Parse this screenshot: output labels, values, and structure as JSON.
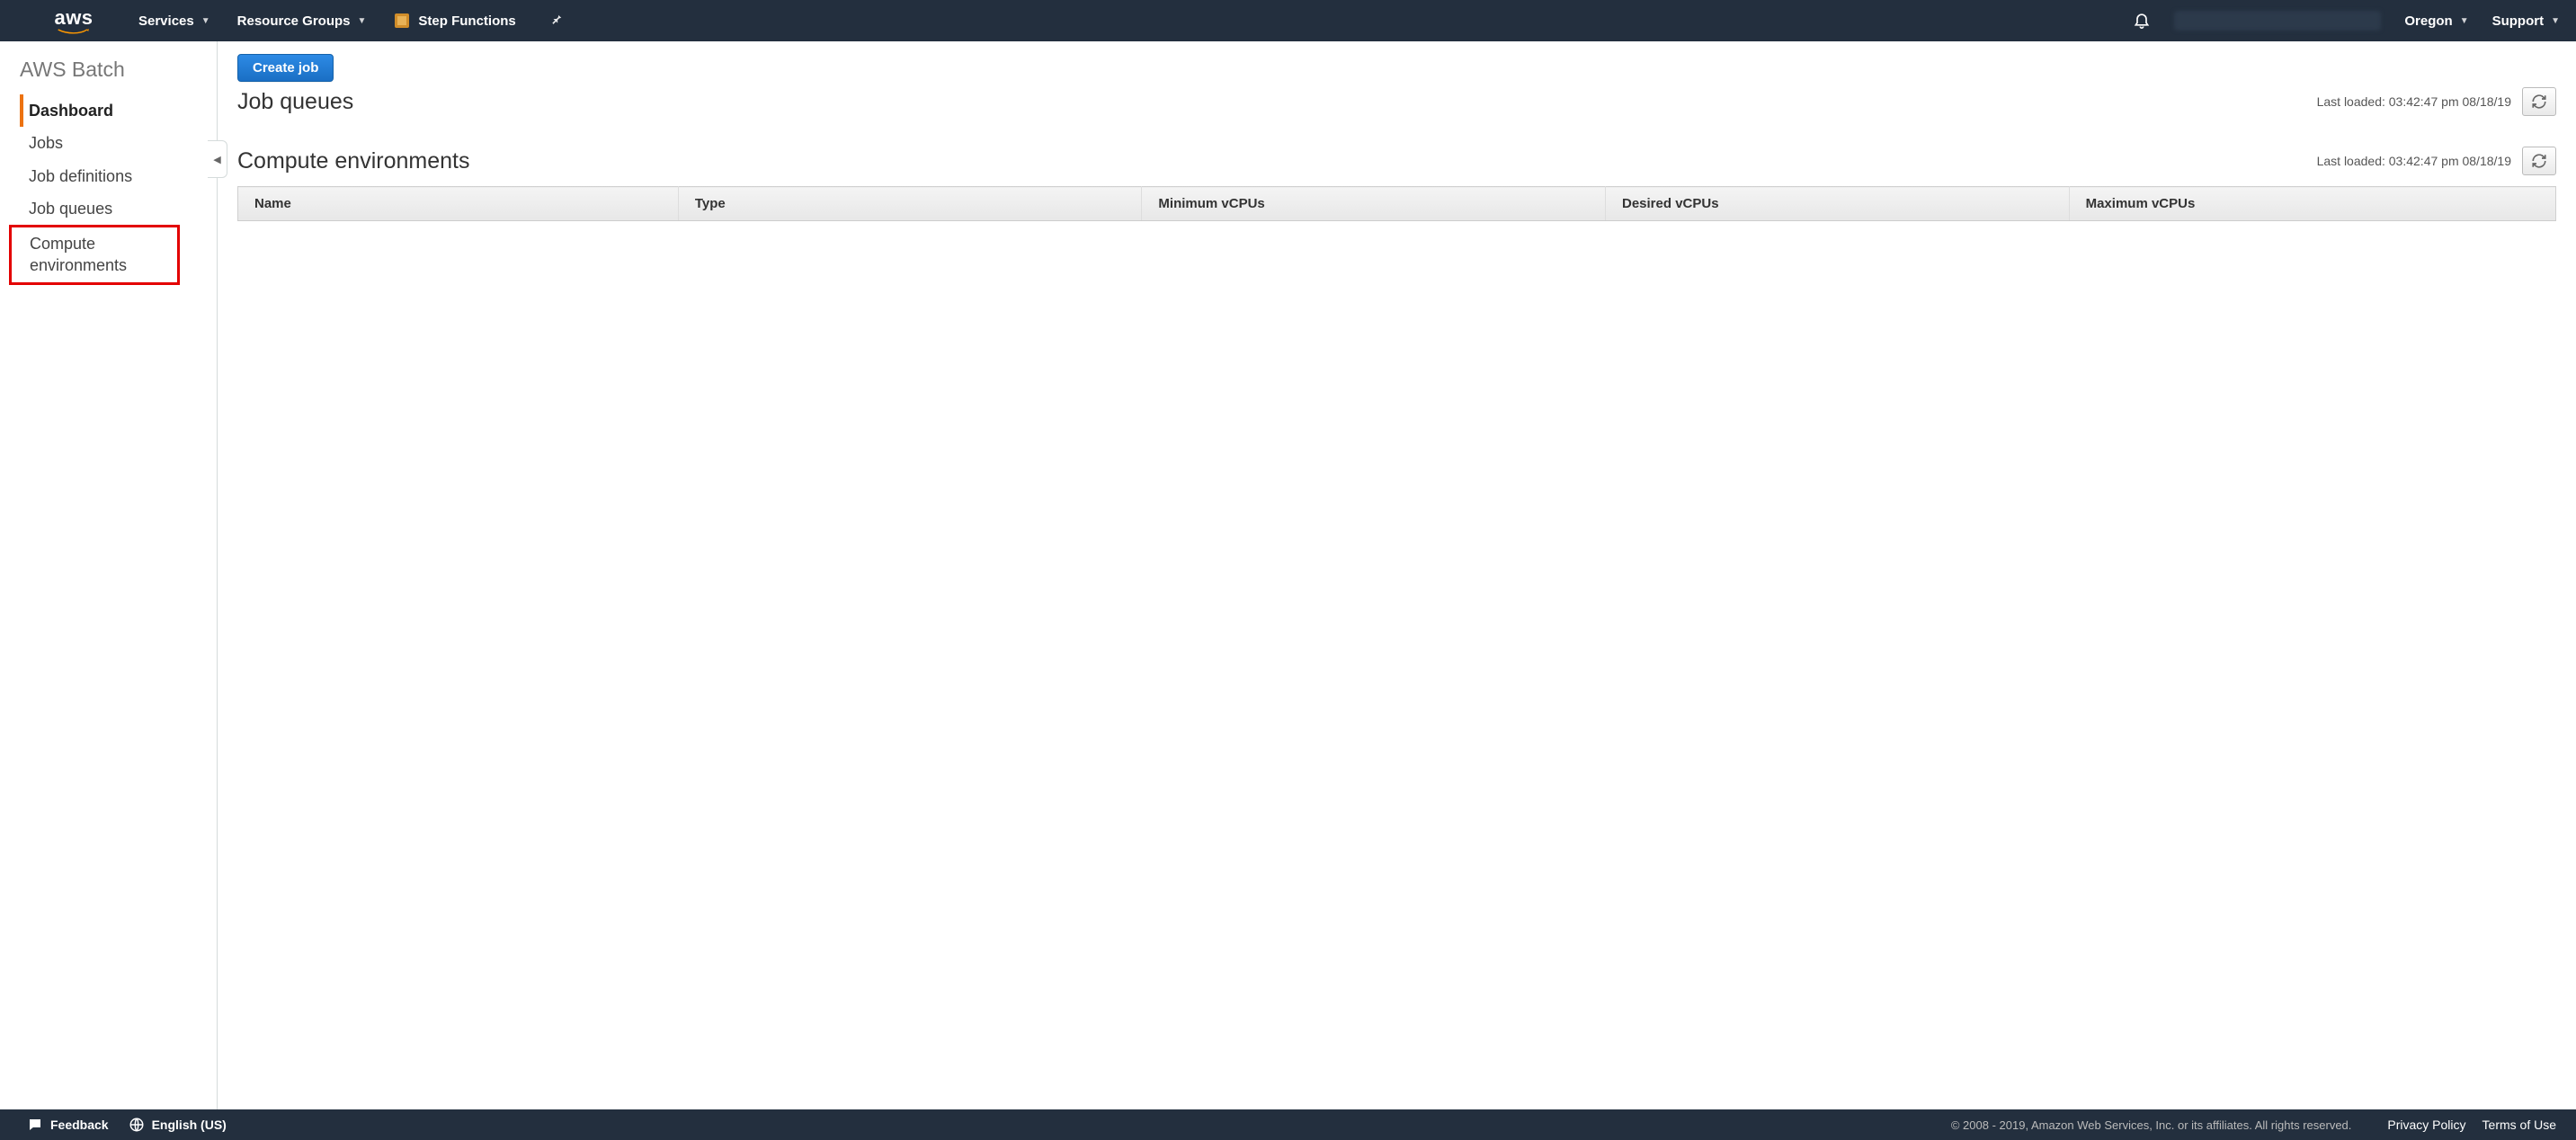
{
  "topnav": {
    "logo_text": "aws",
    "services_label": "Services",
    "resource_groups_label": "Resource Groups",
    "pinned_service_label": "Step Functions",
    "region_label": "Oregon",
    "support_label": "Support"
  },
  "sidebar": {
    "service_title": "AWS Batch",
    "items": [
      {
        "label": "Dashboard",
        "active": true
      },
      {
        "label": "Jobs"
      },
      {
        "label": "Job definitions"
      },
      {
        "label": "Job queues"
      },
      {
        "label": "Compute environments",
        "highlighted": true
      }
    ]
  },
  "main": {
    "create_job_label": "Create job",
    "job_queues": {
      "heading": "Job queues",
      "last_loaded": "Last loaded: 03:42:47 pm 08/18/19"
    },
    "compute_envs": {
      "heading": "Compute environments",
      "last_loaded": "Last loaded: 03:42:47 pm 08/18/19",
      "columns": [
        "Name",
        "Type",
        "Minimum vCPUs",
        "Desired vCPUs",
        "Maximum vCPUs"
      ]
    }
  },
  "footer": {
    "feedback_label": "Feedback",
    "language_label": "English (US)",
    "copyright": "© 2008 - 2019, Amazon Web Services, Inc. or its affiliates. All rights reserved.",
    "privacy_label": "Privacy Policy",
    "terms_label": "Terms of Use"
  }
}
